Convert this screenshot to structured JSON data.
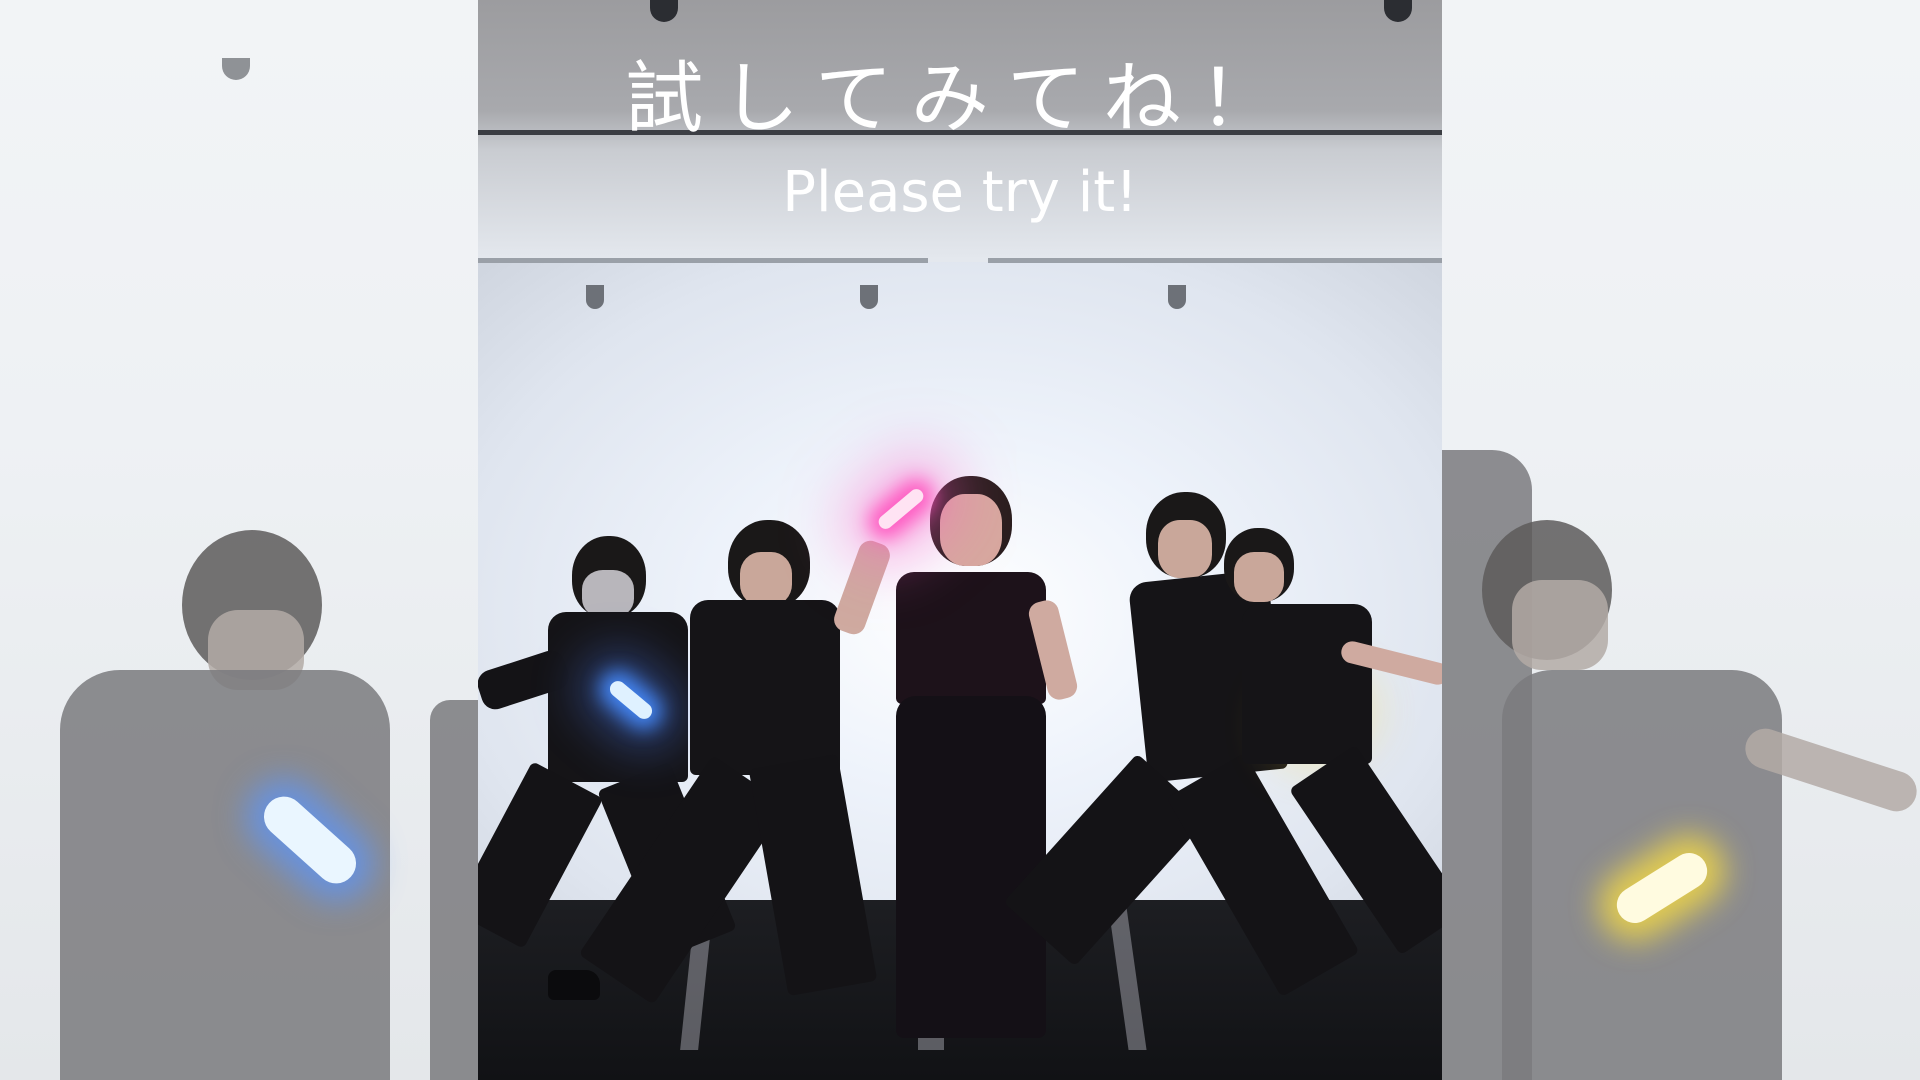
{
  "overlay": {
    "title_jp": "試してみてね！",
    "title_en": "Please try it!"
  },
  "colors": {
    "light_stick_blue": "#4f8cff",
    "light_stick_pink": "#ff5ac8",
    "light_stick_yellow": "#ffe040",
    "outfit": "#151417"
  }
}
